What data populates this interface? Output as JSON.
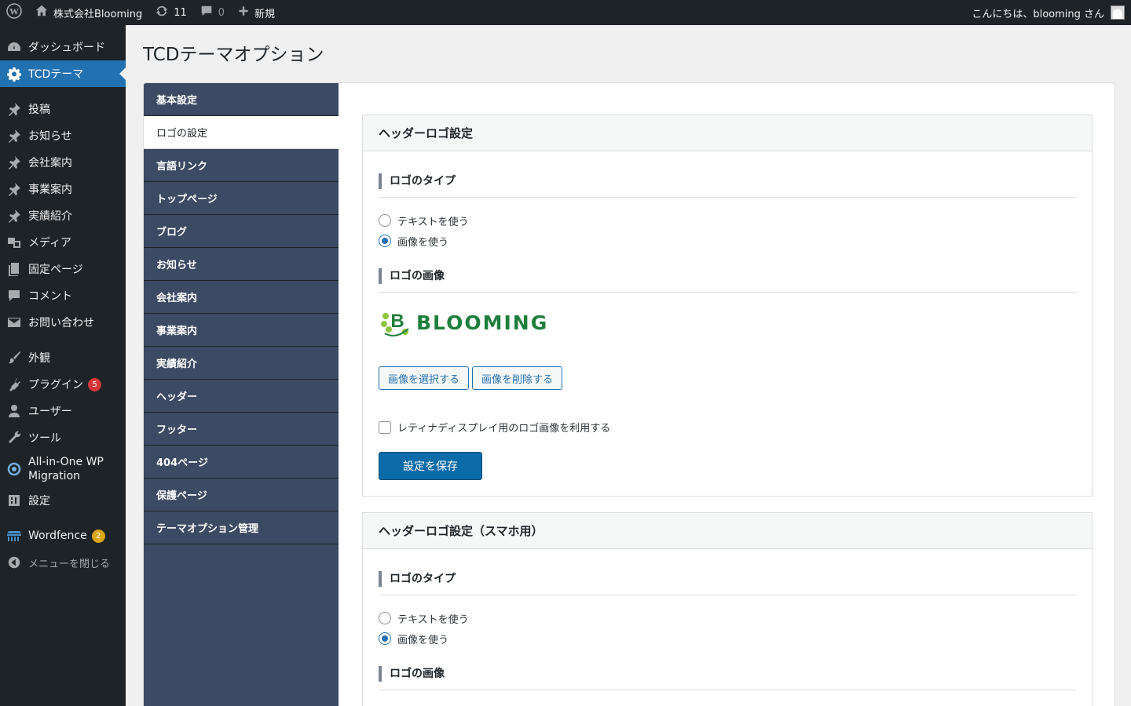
{
  "adminbar": {
    "site_name": "株式会社Blooming",
    "updates_count": "11",
    "comments_count": "0",
    "new_label": "新規",
    "greeting": "こんにちは、blooming さん"
  },
  "sidebar": {
    "items": [
      {
        "label": "ダッシュボード",
        "icon": "dashboard-icon"
      },
      {
        "label": "TCDテーマ",
        "icon": "gear-icon"
      },
      {
        "label": "投稿",
        "icon": "pin-icon"
      },
      {
        "label": "お知らせ",
        "icon": "pin-icon"
      },
      {
        "label": "会社案内",
        "icon": "pin-icon"
      },
      {
        "label": "事業案内",
        "icon": "pin-icon"
      },
      {
        "label": "実績紹介",
        "icon": "pin-icon"
      },
      {
        "label": "メディア",
        "icon": "media-icon"
      },
      {
        "label": "固定ページ",
        "icon": "page-icon"
      },
      {
        "label": "コメント",
        "icon": "comment-icon"
      },
      {
        "label": "お問い合わせ",
        "icon": "mail-icon"
      },
      {
        "label": "外観",
        "icon": "brush-icon"
      },
      {
        "label": "プラグイン",
        "icon": "plugin-icon",
        "badge": "5"
      },
      {
        "label": "ユーザー",
        "icon": "user-icon"
      },
      {
        "label": "ツール",
        "icon": "wrench-icon"
      },
      {
        "label": "All-in-One WP Migration",
        "icon": "migration-icon"
      },
      {
        "label": "設定",
        "icon": "settings-icon"
      },
      {
        "label": "Wordfence",
        "icon": "wordfence-icon",
        "badge": "2"
      },
      {
        "label": "メニューを閉じる",
        "icon": "collapse-icon"
      }
    ]
  },
  "page": {
    "title": "TCDテーマオプション"
  },
  "tabs": [
    "基本設定",
    "ロゴの設定",
    "言語リンク",
    "トップページ",
    "ブログ",
    "お知らせ",
    "会社案内",
    "事業案内",
    "実績紹介",
    "ヘッダー",
    "フッター",
    "404ページ",
    "保護ページ",
    "テーマオプション管理"
  ],
  "section1": {
    "title": "ヘッダーロゴ設定",
    "logo_type_heading": "ロゴのタイプ",
    "radio_text": "テキストを使う",
    "radio_image": "画像を使う",
    "logo_image_heading": "ロゴの画像",
    "logo_text": "BLOOMING",
    "logo_letter": "B",
    "select_button": "画像を選択する",
    "delete_button": "画像を削除する",
    "retina_label": "レティナディスプレイ用のロゴ画像を利用する",
    "save_button": "設定を保存"
  },
  "section2": {
    "title": "ヘッダーロゴ設定（スマホ用）",
    "logo_type_heading": "ロゴのタイプ",
    "radio_text": "テキストを使う",
    "radio_image": "画像を使う",
    "logo_image_heading": "ロゴの画像"
  },
  "colors": {
    "admin_bar": "#1d2327",
    "accent": "#2271b1",
    "tab_bg": "#3c4a63",
    "logo_green": "#1e7e3c"
  }
}
